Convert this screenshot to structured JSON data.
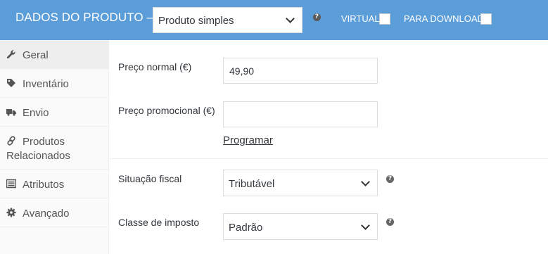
{
  "header": {
    "title": "DADOS DO PRODUTO —",
    "product_type": "Produto simples",
    "virtual_label": "VIRTUAL:",
    "download_label": "PARA DOWNLOAD:",
    "background": "#5b9dd9"
  },
  "sidebar": {
    "items": [
      {
        "label": "Geral",
        "icon": "wrench-icon",
        "active": true
      },
      {
        "label": "Inventário",
        "icon": "tag-icon"
      },
      {
        "label": "Envio",
        "icon": "truck-icon"
      },
      {
        "label": "Produtos Relacionados",
        "icon": "link-icon"
      },
      {
        "label": "Atributos",
        "icon": "list-icon"
      },
      {
        "label": "Avançado",
        "icon": "gear-icon"
      }
    ]
  },
  "pricing": {
    "regular_price_label": "Preço normal (€)",
    "regular_price_value": "49,90",
    "sale_price_label": "Preço promocional (€)",
    "sale_price_value": "",
    "schedule_link": "Programar"
  },
  "tax": {
    "status_label": "Situação fiscal",
    "status_value": "Tributável",
    "class_label": "Classe de imposto",
    "class_value": "Padrão"
  }
}
